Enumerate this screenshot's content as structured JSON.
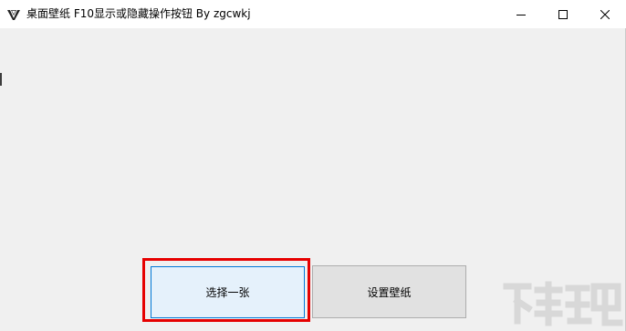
{
  "window": {
    "title": "桌面壁纸 F10显示或隐藏操作按钮 By zgcwkj",
    "app_icon": "app-icon",
    "controls": {
      "minimize_icon": "minimize-icon",
      "maximize_icon": "maximize-icon",
      "close_icon": "close-icon"
    }
  },
  "buttons": {
    "select_one": "选择一张",
    "set_wallpaper": "设置壁纸"
  },
  "colors": {
    "highlight_border": "#e60000",
    "focused_button_bg": "#e5f1fb",
    "focused_button_border": "#0078d7",
    "button_bg": "#e1e1e1",
    "window_bg": "#f0f0f0"
  }
}
